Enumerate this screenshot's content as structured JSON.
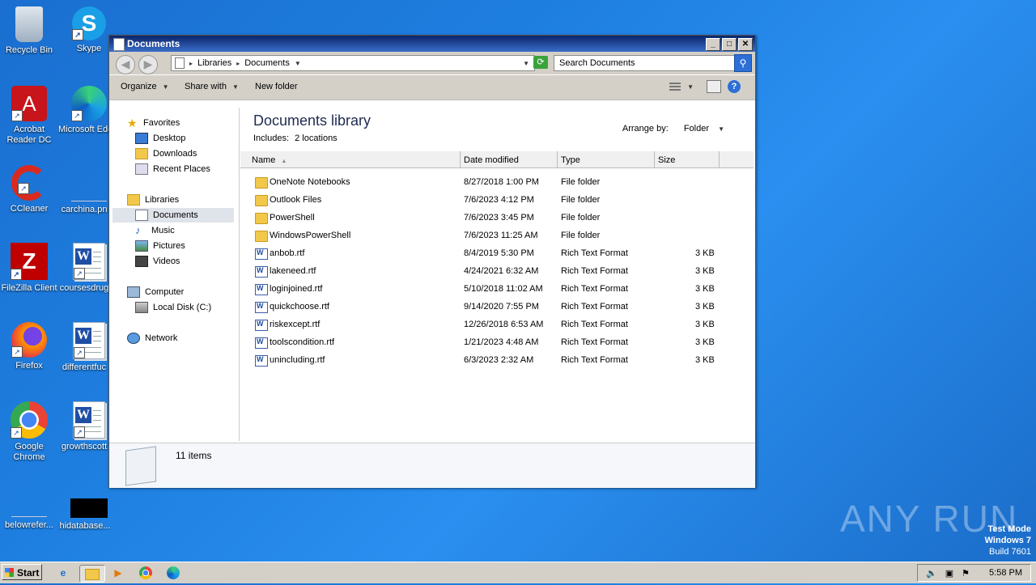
{
  "desktop": {
    "icons": [
      {
        "label": "Recycle Bin"
      },
      {
        "label": "Skype"
      },
      {
        "label": "Acrobat Reader DC"
      },
      {
        "label": "Microsoft Edge"
      },
      {
        "label": "CCleaner"
      },
      {
        "label": "carchina.pn"
      },
      {
        "label": "FileZilla Client"
      },
      {
        "label": "coursesdrug"
      },
      {
        "label": "Firefox"
      },
      {
        "label": "differentfuc"
      },
      {
        "label": "Google Chrome"
      },
      {
        "label": "growthscott"
      },
      {
        "label": "belowrefer..."
      },
      {
        "label": "hidatabase..."
      }
    ],
    "watermark": "ANY RUN",
    "test_mode": {
      "line1": "Test Mode",
      "line2": "Windows 7",
      "line3": "Build 7601"
    }
  },
  "window": {
    "title": "Documents",
    "address": {
      "part1": "Libraries",
      "part2": "Documents"
    },
    "search_placeholder": "Search Documents",
    "toolbar": {
      "organize": "Organize",
      "share_with": "Share with",
      "new_folder": "New folder"
    },
    "nav": {
      "favorites": "Favorites",
      "desktop": "Desktop",
      "downloads": "Downloads",
      "recent_places": "Recent Places",
      "libraries": "Libraries",
      "documents": "Documents",
      "music": "Music",
      "pictures": "Pictures",
      "videos": "Videos",
      "computer": "Computer",
      "local_disk": "Local Disk (C:)",
      "network": "Network"
    },
    "library": {
      "title": "Documents library",
      "includes_label": "Includes:",
      "includes_link": "2 locations",
      "arrange_label": "Arrange by:",
      "arrange_value": "Folder"
    },
    "columns": {
      "name": "Name",
      "date": "Date modified",
      "type": "Type",
      "size": "Size"
    },
    "files": [
      {
        "name": "OneNote Notebooks",
        "date": "8/27/2018 1:00 PM",
        "type": "File folder",
        "size": "",
        "kind": "folder"
      },
      {
        "name": "Outlook Files",
        "date": "7/6/2023 4:12 PM",
        "type": "File folder",
        "size": "",
        "kind": "folder"
      },
      {
        "name": "PowerShell",
        "date": "7/6/2023 3:45 PM",
        "type": "File folder",
        "size": "",
        "kind": "folder"
      },
      {
        "name": "WindowsPowerShell",
        "date": "7/6/2023 11:25 AM",
        "type": "File folder",
        "size": "",
        "kind": "folder"
      },
      {
        "name": "anbob.rtf",
        "date": "8/4/2019 5:30 PM",
        "type": "Rich Text Format",
        "size": "3 KB",
        "kind": "rtf"
      },
      {
        "name": "lakeneed.rtf",
        "date": "4/24/2021 6:32 AM",
        "type": "Rich Text Format",
        "size": "3 KB",
        "kind": "rtf"
      },
      {
        "name": "loginjoined.rtf",
        "date": "5/10/2018 11:02 AM",
        "type": "Rich Text Format",
        "size": "3 KB",
        "kind": "rtf"
      },
      {
        "name": "quickchoose.rtf",
        "date": "9/14/2020 7:55 PM",
        "type": "Rich Text Format",
        "size": "3 KB",
        "kind": "rtf"
      },
      {
        "name": "riskexcept.rtf",
        "date": "12/26/2018 6:53 AM",
        "type": "Rich Text Format",
        "size": "3 KB",
        "kind": "rtf"
      },
      {
        "name": "toolscondition.rtf",
        "date": "1/21/2023 4:48 AM",
        "type": "Rich Text Format",
        "size": "3 KB",
        "kind": "rtf"
      },
      {
        "name": "unincluding.rtf",
        "date": "6/3/2023 2:32 AM",
        "type": "Rich Text Format",
        "size": "3 KB",
        "kind": "rtf"
      }
    ],
    "status": {
      "count": "11 items"
    }
  },
  "taskbar": {
    "start": "Start",
    "time": "5:58 PM"
  }
}
